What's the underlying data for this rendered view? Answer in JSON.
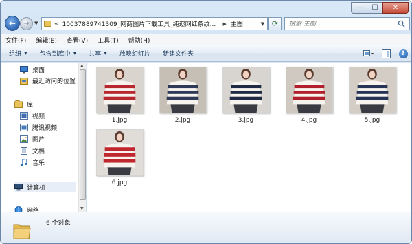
{
  "window": {
    "minimize": "—",
    "maximize": "☐",
    "close": "✕"
  },
  "address": {
    "chevrons": "«",
    "path": "10037889741309_网商图片下载工具_纯迩网红条纹...",
    "separator": "▶",
    "current": "主图"
  },
  "search": {
    "placeholder": "搜索 主图"
  },
  "menu": [
    "文件(F)",
    "编辑(E)",
    "查看(V)",
    "工具(T)",
    "帮助(H)"
  ],
  "toolbar": {
    "items": [
      "组织",
      "包含到库中",
      "共享",
      "放映幻灯片",
      "新建文件夹"
    ],
    "help": "?"
  },
  "nav": {
    "items": [
      {
        "label": "桌面",
        "icon": "desktop-icon"
      },
      {
        "label": "最近访问的位置",
        "icon": "recent-places-icon"
      },
      {
        "label": "库",
        "icon": "library-icon"
      },
      {
        "label": "视频",
        "icon": "video-icon"
      },
      {
        "label": "腾讯视频",
        "icon": "tencent-video-icon"
      },
      {
        "label": "图片",
        "icon": "pictures-icon"
      },
      {
        "label": "文档",
        "icon": "documents-icon"
      },
      {
        "label": "音乐",
        "icon": "music-icon"
      },
      {
        "label": "计算机",
        "icon": "computer-icon"
      },
      {
        "label": "网络",
        "icon": "network-icon"
      }
    ]
  },
  "files": [
    {
      "name": "1.jpg",
      "stripe": "#b8262e",
      "bg": "#d9d4ce"
    },
    {
      "name": "2.jpg",
      "stripe": "#2e3a57",
      "bg": "#c6bfb6"
    },
    {
      "name": "3.jpg",
      "stripe": "#1f2a44",
      "bg": "#d8d5d0"
    },
    {
      "name": "4.jpg",
      "stripe": "#b01f2b",
      "bg": "#cfc9c2"
    },
    {
      "name": "5.jpg",
      "stripe": "#253457",
      "bg": "#d3cdc5"
    },
    {
      "name": "6.jpg",
      "stripe": "#c0272f",
      "bg": "#e0dcd8"
    }
  ],
  "details": {
    "count": "6 个对象"
  }
}
